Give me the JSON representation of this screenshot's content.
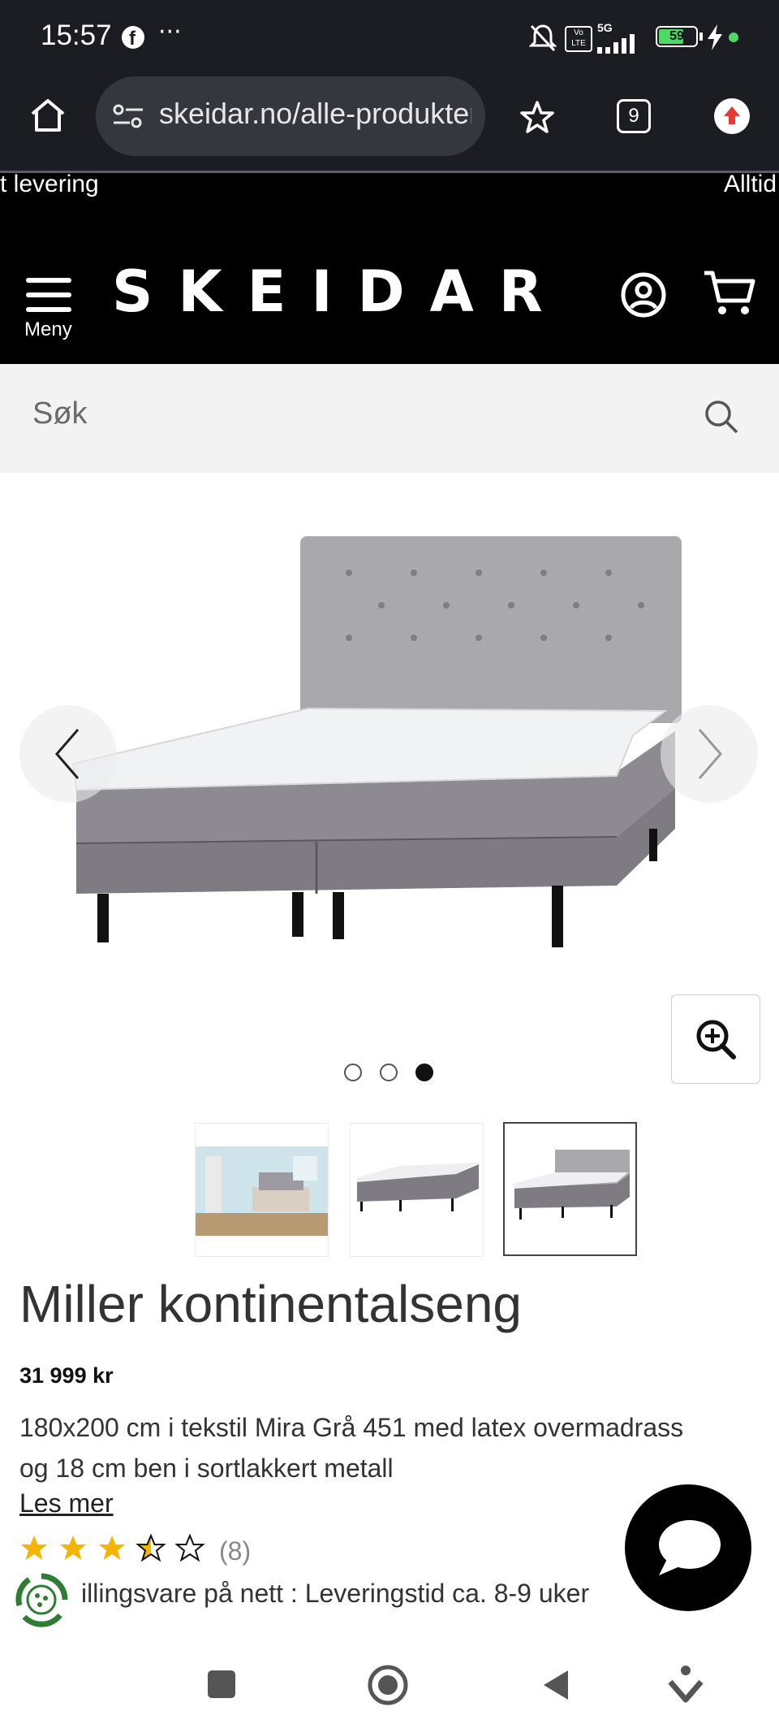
{
  "status_bar": {
    "time": "15:57",
    "battery": "59",
    "network": "5G",
    "icons": [
      "facebook-icon",
      "more-icon",
      "mute-icon",
      "volte-icon",
      "signal-icon",
      "battery-icon",
      "charging-icon"
    ]
  },
  "browser": {
    "url": "skeidar.no/alle-produkter",
    "tab_count": "9",
    "icons": [
      "home-icon",
      "site-settings-icon",
      "bookmark-star-icon",
      "tabs-icon",
      "update-icon"
    ]
  },
  "promo_ticker": {
    "left_text": "t levering",
    "right_text": "Alltid"
  },
  "header": {
    "logo": "SKEIDAR",
    "menu_label": "Meny"
  },
  "search": {
    "placeholder": "Søk"
  },
  "gallery": {
    "image_count": 3,
    "active_index": 3
  },
  "product": {
    "title": "Miller kontinentalseng",
    "price": "31 999 kr",
    "description": "180x200 cm i tekstil Mira Grå 451 med latex overmadrass og 18 cm ben i sortlakkert metall",
    "read_more": "Les mer",
    "rating": 3.5,
    "rating_max": 5,
    "rating_count": "(8)",
    "delivery_text": "illingsvare på nett : Leveringstid ca. 8-9 uker"
  },
  "colors": {
    "header_bg": "#000000",
    "browser_bg": "#1b1d22",
    "star_color": "#f5b400",
    "search_bg": "#f3f3f3"
  }
}
